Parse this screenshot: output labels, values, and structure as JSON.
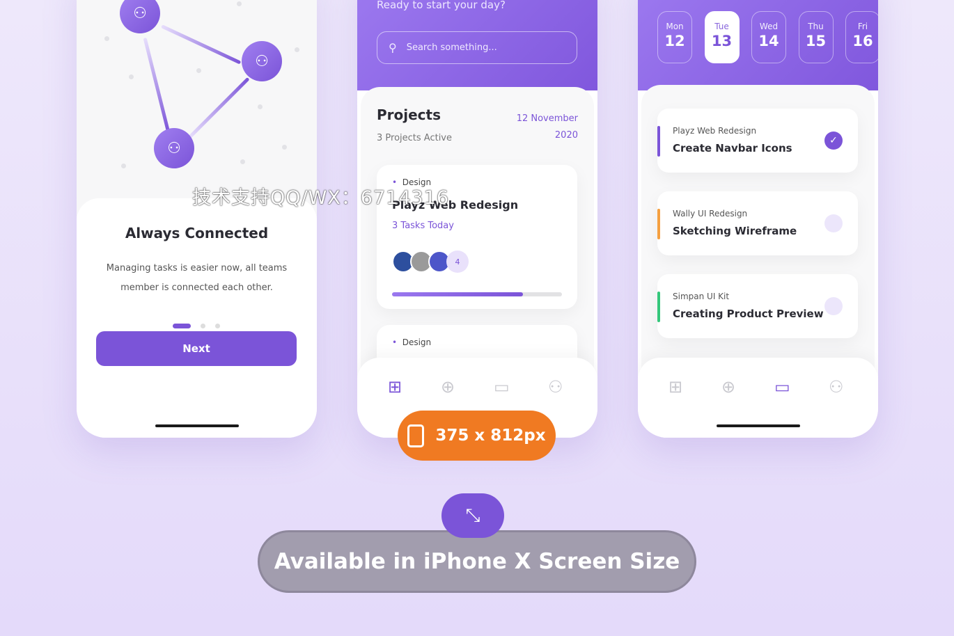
{
  "onboarding": {
    "title": "Always Connected",
    "description_line1": "Managing tasks is easier now, all teams",
    "description_line2": "member is connected each other.",
    "next_label": "Next",
    "page_index": 1,
    "page_count": 3
  },
  "home": {
    "greeting": "Ready to start your day?",
    "search_placeholder": "Search something...",
    "projects_title": "Projects",
    "projects_active": "3 Projects Active",
    "date_line1": "12 November",
    "date_line2": "2020",
    "cards": [
      {
        "category": "Design",
        "title": "Playz Web Redesign",
        "tasks": "3 Tasks Today",
        "extra_members": "4",
        "progress": 0.77
      },
      {
        "category": "Design"
      }
    ]
  },
  "schedule": {
    "days": [
      {
        "name": "Mon",
        "num": "12"
      },
      {
        "name": "Tue",
        "num": "13",
        "selected": true
      },
      {
        "name": "Wed",
        "num": "14"
      },
      {
        "name": "Thu",
        "num": "15"
      },
      {
        "name": "Fri",
        "num": "16"
      }
    ],
    "tasks": [
      {
        "project": "Playz Web Redesign",
        "title": "Create Navbar Icons",
        "color": "#7b54d8",
        "done": true
      },
      {
        "project": "Wally UI Redesign",
        "title": "Sketching Wireframe",
        "color": "#f5a040",
        "done": false
      },
      {
        "project": "Simpan UI Kit",
        "title": "Creating Product Preview",
        "color": "#34c77b",
        "done": false
      }
    ]
  },
  "size_badge": {
    "label": "375 x 812px",
    "icon": "phone-icon",
    "color": "#f07a22"
  },
  "banner": {
    "label": "Available in iPhone X Screen Size",
    "icon": "minimize-arrows-icon"
  },
  "watermark": "技术支持QQ/WX：6714316",
  "colors": {
    "accent": "#7b54d8",
    "background": "#e8e0fa"
  }
}
